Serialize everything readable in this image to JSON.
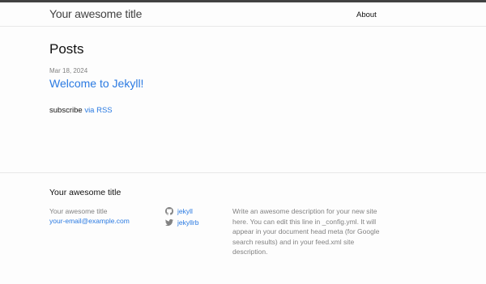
{
  "header": {
    "site_title": "Your awesome title",
    "nav": [
      {
        "label": "About"
      }
    ]
  },
  "main": {
    "heading": "Posts",
    "posts": [
      {
        "date": "Mar 18, 2024",
        "title": "Welcome to Jekyll!"
      }
    ],
    "rss": {
      "prefix": "subscribe ",
      "link_label": "via RSS"
    }
  },
  "footer": {
    "heading": "Your awesome title",
    "contact_name": "Your awesome title",
    "email": "your-email@example.com",
    "social": [
      {
        "icon": "github-icon",
        "label": "jekyll"
      },
      {
        "icon": "twitter-icon",
        "label": "jekyllrb"
      }
    ],
    "description": "Write an awesome description for your new site here. You can edit this line in _config.yml. It will appear in your document head meta (for Google search results) and in your feed.xml site description."
  },
  "colors": {
    "link": "#2a7ae2",
    "text": "#111111",
    "muted": "#828282",
    "header_border": "#424242",
    "divider": "#e8e8e8"
  }
}
